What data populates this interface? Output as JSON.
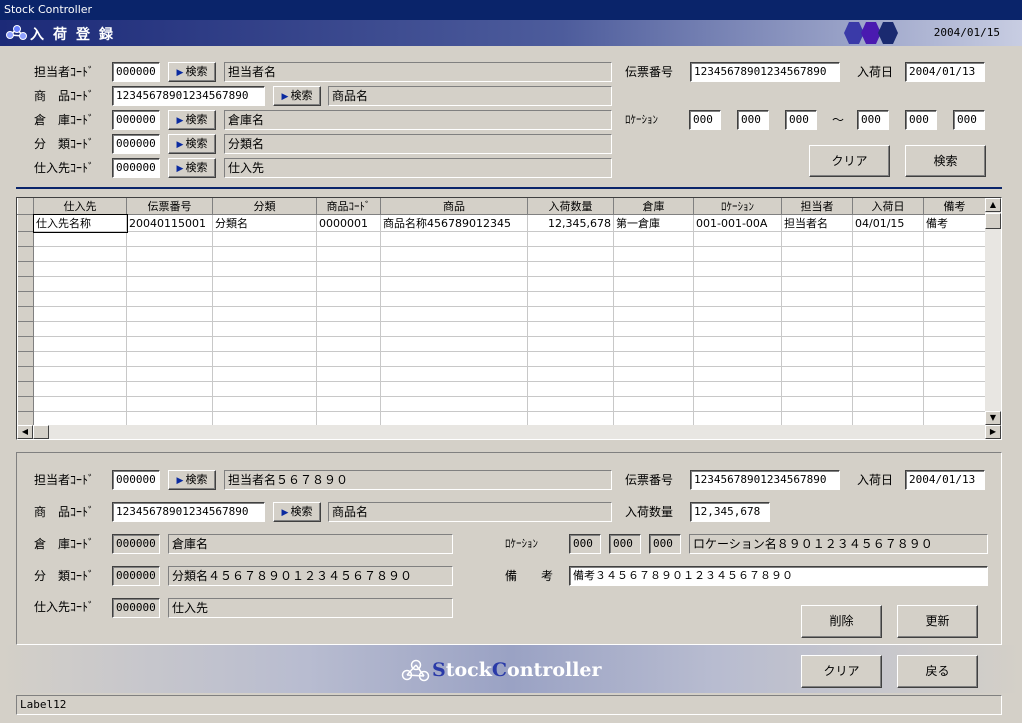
{
  "window": {
    "title": "Stock Controller"
  },
  "header": {
    "title": "入荷登録",
    "date": "2004/01/15"
  },
  "search": {
    "tanto_label": "担当者ｺｰﾄﾞ",
    "tanto_code": "000000",
    "tanto_name": "担当者名",
    "shohin_label": "商　品ｺｰﾄﾞ",
    "shohin_code": "12345678901234567890",
    "shohin_name": "商品名",
    "soko_label": "倉　庫ｺｰﾄﾞ",
    "soko_code": "000000",
    "soko_name": "倉庫名",
    "bunrui_label": "分　類ｺｰﾄﾞ",
    "bunrui_code": "000000",
    "bunrui_name": "分類名",
    "shiire_label": "仕入先ｺｰﾄﾞ",
    "shiire_code": "000000",
    "shiire_name": "仕入先",
    "search_button": "検索",
    "denpyo_label": "伝票番号",
    "denpyo_value": "12345678901234567890",
    "nyuka_label": "入荷日",
    "nyuka_value": "2004/01/13",
    "location_label": "ﾛｹｰｼｮﾝ",
    "loc_from": [
      "000",
      "000",
      "000"
    ],
    "loc_tilde": "～",
    "loc_to": [
      "000",
      "000",
      "000"
    ],
    "clear_button": "クリア",
    "find_button": "検索"
  },
  "grid": {
    "columns": [
      "仕入先",
      "伝票番号",
      "分類",
      "商品ｺｰﾄﾞ",
      "商品",
      "入荷数量",
      "倉庫",
      "ﾛｹｰｼｮﾝ",
      "担当者",
      "入荷日",
      "備考"
    ],
    "rows": [
      [
        "仕入先名称",
        "20040115001",
        "分類名",
        "0000001",
        "商品名称456789012345",
        "12,345,678",
        "第一倉庫",
        "001-001-00A",
        "担当者名",
        "04/01/15",
        "備考"
      ]
    ],
    "empty_rows": 14
  },
  "detail": {
    "tanto_label": "担当者ｺｰﾄﾞ",
    "tanto_code": "000000",
    "tanto_name": "担当者名５６７８９０",
    "shohin_label": "商　品ｺｰﾄﾞ",
    "shohin_code": "12345678901234567890",
    "shohin_name": "商品名",
    "soko_label": "倉　庫ｺｰﾄﾞ",
    "soko_code": "000000",
    "soko_name": "倉庫名",
    "bunrui_label": "分　類ｺｰﾄﾞ",
    "bunrui_code": "000000",
    "bunrui_name": "分類名４５６７８９０１２３４５６７８９０",
    "shiire_label": "仕入先ｺｰﾄﾞ",
    "shiire_code": "000000",
    "shiire_name": "仕入先",
    "search_button": "検索",
    "denpyo_label": "伝票番号",
    "denpyo_value": "12345678901234567890",
    "nyuka_label": "入荷日",
    "nyuka_value": "2004/01/13",
    "qty_label": "入荷数量",
    "qty_value": "12,345,678",
    "location_label": "ﾛｹｰｼｮﾝ",
    "loc": [
      "000",
      "000",
      "000"
    ],
    "loc_name": "ロケーション名８９０１２３４５６７８９０",
    "biko_label": "備　　考",
    "biko_value": "備考３４５６７８９０１２３４５６７８９０",
    "delete_button": "削除",
    "update_button": "更新"
  },
  "footer": {
    "logo_prefix": "S",
    "logo_mid": "tock",
    "logo_c": "C",
    "logo_end": "ontroller",
    "clear_button": "クリア",
    "back_button": "戻る",
    "status": "Label12"
  }
}
